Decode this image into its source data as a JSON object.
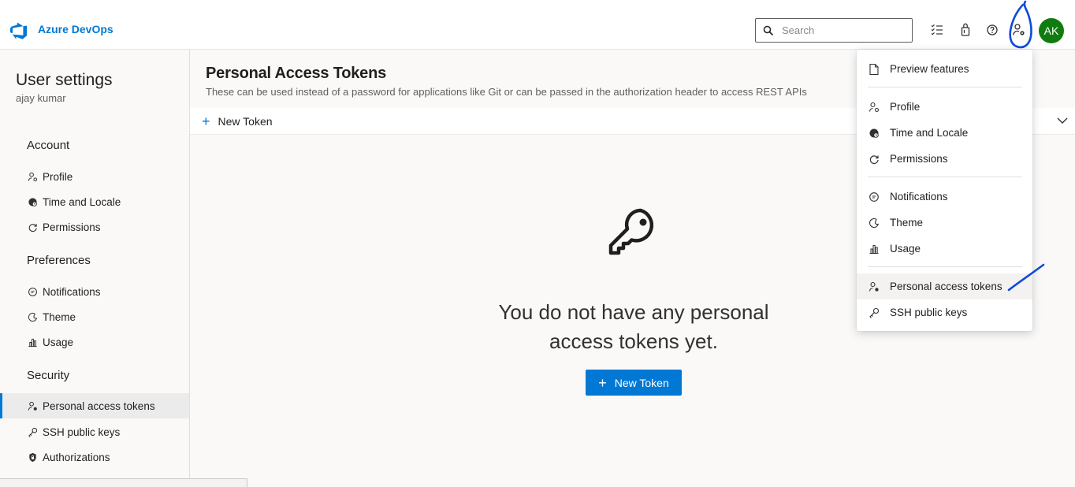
{
  "header": {
    "brand_name": "Azure DevOps",
    "search_placeholder": "Search",
    "icons": [
      "task-list-icon",
      "marketplace-icon",
      "help-icon",
      "user-settings-icon"
    ],
    "avatar_initials": "AK"
  },
  "sidebar": {
    "title": "User settings",
    "user_name": "ajay kumar",
    "groups": [
      {
        "label": "Account",
        "items": [
          {
            "label": "Profile",
            "icon": "profile-icon"
          },
          {
            "label": "Time and Locale",
            "icon": "globe-icon"
          },
          {
            "label": "Permissions",
            "icon": "permissions-icon"
          }
        ]
      },
      {
        "label": "Preferences",
        "items": [
          {
            "label": "Notifications",
            "icon": "notifications-icon"
          },
          {
            "label": "Theme",
            "icon": "theme-icon"
          },
          {
            "label": "Usage",
            "icon": "usage-icon"
          }
        ]
      },
      {
        "label": "Security",
        "items": [
          {
            "label": "Personal access tokens",
            "icon": "token-icon",
            "active": true
          },
          {
            "label": "SSH public keys",
            "icon": "key-icon"
          },
          {
            "label": "Authorizations",
            "icon": "lock-icon"
          }
        ]
      }
    ]
  },
  "main": {
    "title": "Personal Access Tokens",
    "description": "These can be used instead of a password for applications like Git or can be passed in the authorization header to access REST APIs",
    "new_token_command": "New Token",
    "empty_message": "You do not have any personal access tokens yet.",
    "new_token_button": "New Token"
  },
  "menu": {
    "items": [
      {
        "label": "Preview features",
        "icon": "document-icon"
      },
      {
        "label": "Profile",
        "icon": "profile-icon"
      },
      {
        "label": "Time and Locale",
        "icon": "globe-icon"
      },
      {
        "label": "Permissions",
        "icon": "permissions-icon"
      },
      {
        "label": "Notifications",
        "icon": "notifications-icon"
      },
      {
        "label": "Theme",
        "icon": "theme-icon"
      },
      {
        "label": "Usage",
        "icon": "usage-icon"
      },
      {
        "label": "Personal access tokens",
        "icon": "token-icon",
        "active": true
      },
      {
        "label": "SSH public keys",
        "icon": "key-icon"
      }
    ]
  },
  "colors": {
    "accent": "#0078d4",
    "avatar_bg": "#107c10",
    "annotation_ink": "#0a4bd8"
  }
}
